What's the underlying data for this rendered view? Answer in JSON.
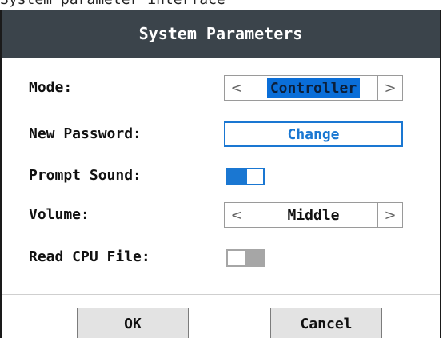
{
  "caption_fragment": "System parameter interface",
  "dialog": {
    "title": "System Parameters"
  },
  "fields": {
    "mode": {
      "label": "Mode:",
      "value": "Controller",
      "prev_glyph": "<",
      "next_glyph": ">"
    },
    "new_password": {
      "label": "New Password:",
      "button_label": "Change"
    },
    "prompt_sound": {
      "label": "Prompt Sound:",
      "enabled": true
    },
    "volume": {
      "label": "Volume:",
      "value": "Middle",
      "prev_glyph": "<",
      "next_glyph": ">"
    },
    "read_cpu_file": {
      "label": "Read CPU File:",
      "enabled": false
    }
  },
  "footer": {
    "ok_label": "OK",
    "cancel_label": "Cancel"
  },
  "colors": {
    "titlebar": "#3b444b",
    "accent": "#1a77d2",
    "selection": "#0a6ed8",
    "toggle_off": "#a6a6a6",
    "button_face": "#e3e3e3"
  }
}
